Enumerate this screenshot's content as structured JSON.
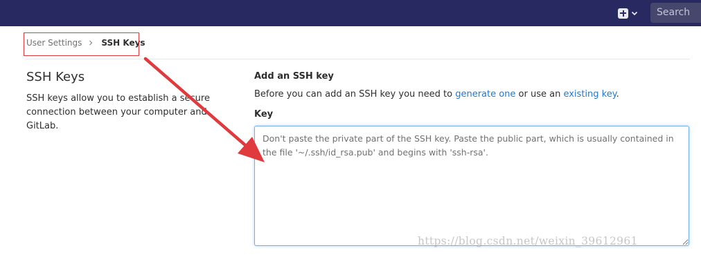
{
  "header": {
    "search_label": "Search",
    "new_menu_icon": "plus-square-icon",
    "bg_color": "#292961"
  },
  "breadcrumb": {
    "parent": "User Settings",
    "current": "SSH Keys"
  },
  "left": {
    "title": "SSH Keys",
    "description": "SSH keys allow you to establish a secure connection between your computer and GitLab."
  },
  "form": {
    "heading": "Add an SSH key",
    "intro_before": "Before you can add an SSH key you need to ",
    "link_generate": "generate one",
    "intro_middle": " or use an ",
    "link_existing": "existing key",
    "intro_end": ".",
    "key_label": "Key",
    "key_placeholder": "Don't paste the private part of the SSH key. Paste the public part, which is usually contained in the file '~/.ssh/id_rsa.pub' and begins with 'ssh-rsa'."
  },
  "colors": {
    "link": "#1f78d1",
    "annotation": "#e0393e"
  },
  "watermark": "https://blog.csdn.net/weixin_39612961"
}
